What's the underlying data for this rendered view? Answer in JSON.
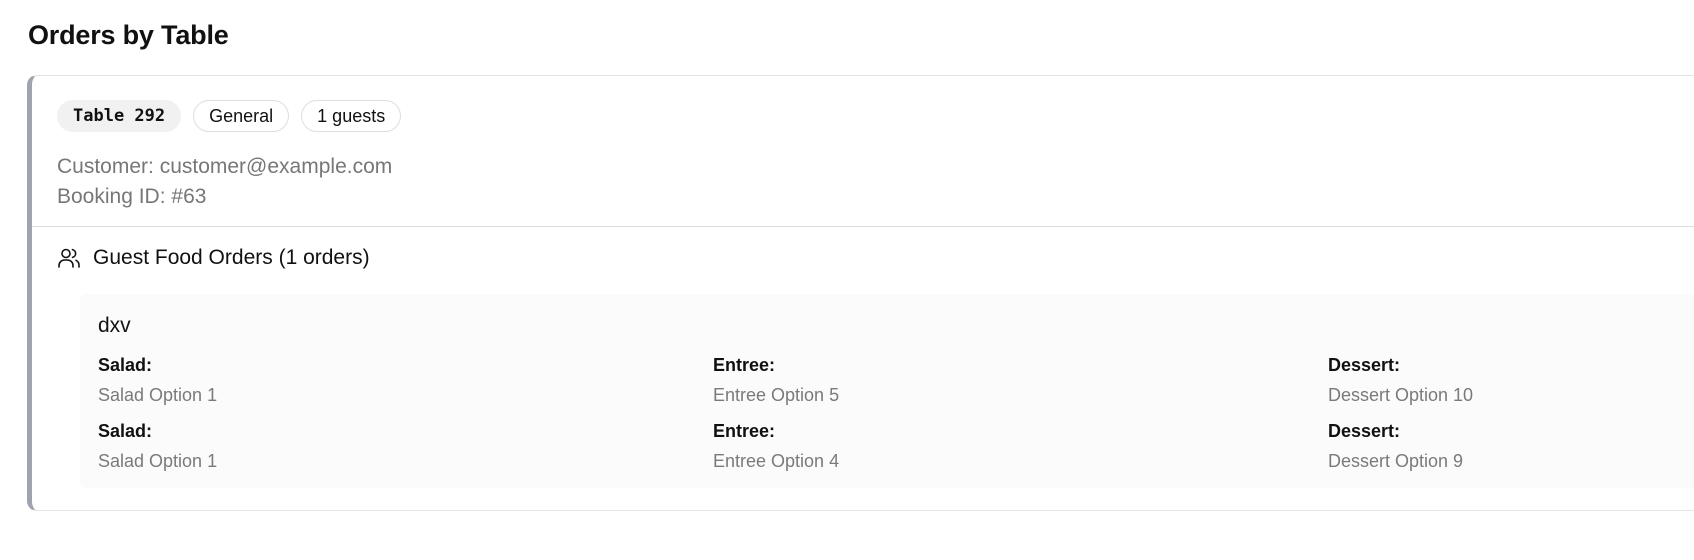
{
  "page": {
    "title": "Orders by Table"
  },
  "booking": {
    "table_badge": "Table 292",
    "type_badge": "General",
    "guests_badge": "1 guests",
    "customer": "Customer: customer@example.com",
    "booking_id": "Booking ID: #63"
  },
  "section": {
    "icon": "users-icon",
    "title": "Guest Food Orders (1 orders)"
  },
  "orders": [
    {
      "guest": "dxv",
      "rows": [
        [
          {
            "label": "Salad:",
            "value": "Salad Option 1"
          },
          {
            "label": "Entree:",
            "value": "Entree Option 5"
          },
          {
            "label": "Dessert:",
            "value": "Dessert Option 10"
          }
        ],
        [
          {
            "label": "Salad:",
            "value": "Salad Option 1"
          },
          {
            "label": "Entree:",
            "value": "Entree Option 4"
          },
          {
            "label": "Dessert:",
            "value": "Dessert Option 9"
          }
        ]
      ]
    }
  ],
  "colors": {
    "card_accent": "#9ea3ae",
    "muted_text": "#777777",
    "order_bg": "#fbfbfb"
  }
}
